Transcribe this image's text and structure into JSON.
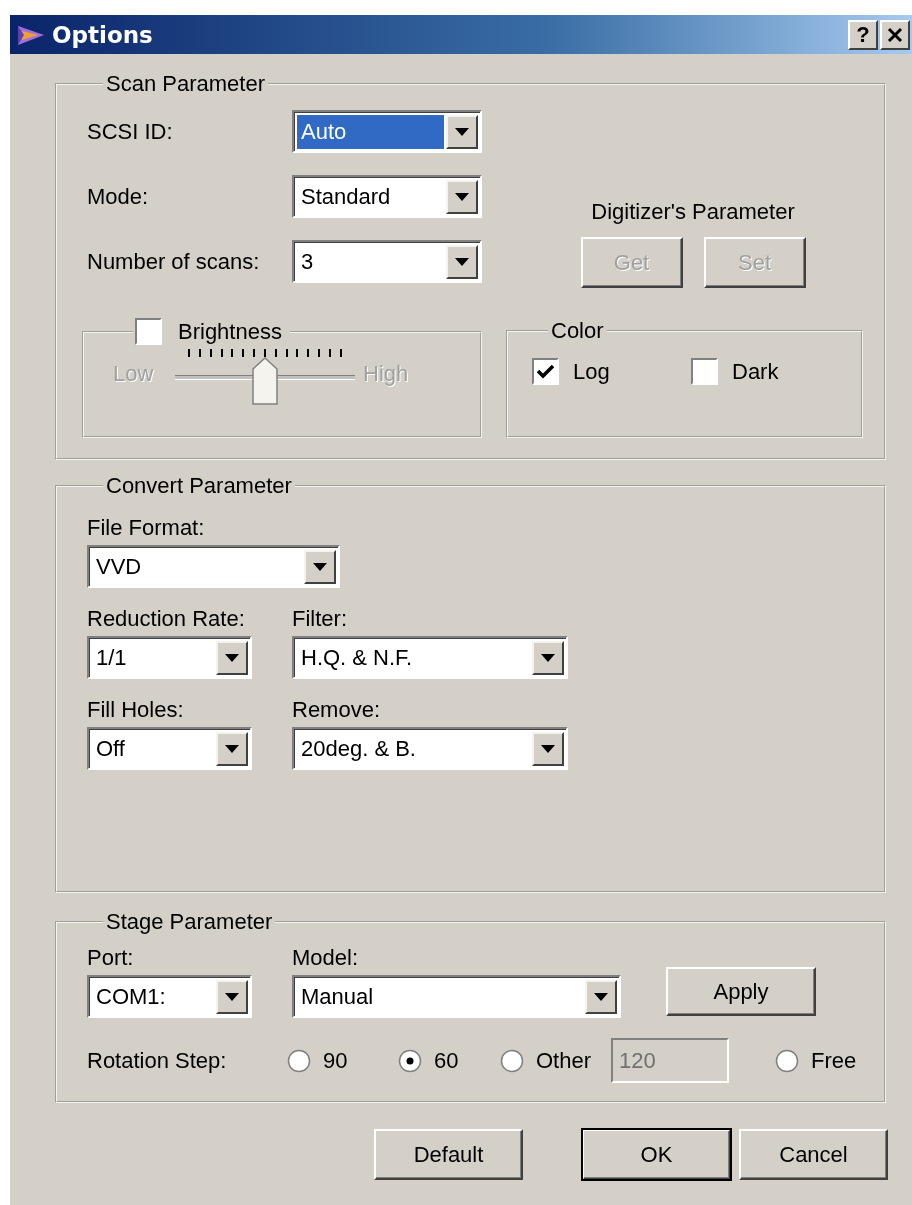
{
  "window": {
    "title": "Options",
    "help_button": "?"
  },
  "scan_parameter": {
    "title": "Scan Parameter",
    "fields": [
      {
        "label": "SCSI ID:",
        "value": "Auto",
        "highlighted": true
      },
      {
        "label": "Mode:",
        "value": "Standard",
        "highlighted": false
      },
      {
        "label": "Number of scans:",
        "value": "3",
        "highlighted": false
      }
    ],
    "digitizer": {
      "title": "Digitizer's Parameter",
      "buttons": [
        {
          "label": "Get",
          "disabled": true
        },
        {
          "label": "Set",
          "disabled": true
        }
      ]
    },
    "brightness": {
      "label": "Brightness",
      "checked": false,
      "disabled": true,
      "low_label": "Low",
      "high_label": "High",
      "level": 0.5
    },
    "color": {
      "title": "Color",
      "options": [
        {
          "label": "Log",
          "checked": true
        },
        {
          "label": "Dark",
          "checked": false
        }
      ]
    }
  },
  "convert_parameter": {
    "title": "Convert Parameter",
    "file_format": {
      "label": "File Format:",
      "value": "VVD"
    },
    "rows": [
      {
        "fields": [
          {
            "label": "Reduction Rate:",
            "value": "1/1"
          },
          {
            "label": "Filter:",
            "value": "H.Q. & N.F."
          }
        ]
      },
      {
        "fields": [
          {
            "label": "Fill Holes:",
            "value": "Off"
          },
          {
            "label": "Remove:",
            "value": "20deg. & B."
          }
        ]
      }
    ]
  },
  "stage_parameter": {
    "title": "Stage Parameter",
    "port": {
      "label": "Port:",
      "value": "COM1:"
    },
    "model": {
      "label": "Model:",
      "value": "Manual"
    },
    "apply_button": "Apply",
    "rotation": {
      "label": "Rotation Step:",
      "options": [
        {
          "label": "90",
          "selected": false
        },
        {
          "label": "60",
          "selected": true
        },
        {
          "label": "Other",
          "selected": false,
          "field": {
            "value": "120",
            "disabled": true
          }
        },
        {
          "label": "Free",
          "selected": false
        }
      ]
    }
  },
  "buttons": [
    {
      "label": "Default",
      "default": false
    },
    {
      "label": "OK",
      "default": true
    },
    {
      "label": "Cancel",
      "default": false
    }
  ]
}
